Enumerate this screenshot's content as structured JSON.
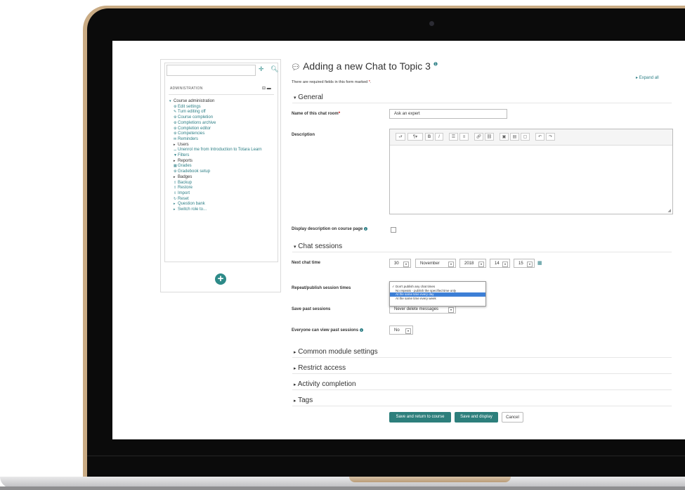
{
  "sidebar": {
    "title": "ADMINISTRATION",
    "items": [
      {
        "label": "Course administration",
        "icon": "caret-down-icon",
        "level": 0
      },
      {
        "label": "Edit settings",
        "icon": "gear-icon",
        "level": 1
      },
      {
        "label": "Turn editing off",
        "icon": "pencil-icon",
        "level": 1
      },
      {
        "label": "Course completion",
        "icon": "gear-icon",
        "level": 1
      },
      {
        "label": "Completions archive",
        "icon": "gear-icon",
        "level": 1
      },
      {
        "label": "Completion editor",
        "icon": "gear-icon",
        "level": 1
      },
      {
        "label": "Competencies",
        "icon": "gear-icon",
        "level": 1
      },
      {
        "label": "Reminders",
        "icon": "envelope-icon",
        "level": 1
      },
      {
        "label": "Users",
        "icon": "caret-right-icon",
        "level": 1
      },
      {
        "label": "Unenrol me from Introduction to Totara Learn",
        "icon": "user-minus-icon",
        "level": 1
      },
      {
        "label": "Filters",
        "icon": "filter-icon",
        "level": 1
      },
      {
        "label": "Reports",
        "icon": "caret-right-icon",
        "level": 1
      },
      {
        "label": "Grades",
        "icon": "table-icon",
        "level": 1
      },
      {
        "label": "Gradebook setup",
        "icon": "gear-icon",
        "level": 1
      },
      {
        "label": "Badges",
        "icon": "caret-right-icon",
        "level": 1
      },
      {
        "label": "Backup",
        "icon": "upload-icon",
        "level": 1
      },
      {
        "label": "Restore",
        "icon": "upload-icon",
        "level": 1
      },
      {
        "label": "Import",
        "icon": "upload-icon",
        "level": 1
      },
      {
        "label": "Reset",
        "icon": "reset-icon",
        "level": 1
      },
      {
        "label": "Question bank",
        "icon": "caret-right-icon",
        "level": 1
      },
      {
        "label": "Switch role to...",
        "icon": "caret-right-icon",
        "level": 1
      }
    ]
  },
  "page": {
    "title": "Adding a new Chat to Topic 3",
    "required_note": "There are required fields in this form marked",
    "required_star": "*",
    "expand_all": "Expand all"
  },
  "general": {
    "header": "General",
    "name_label": "Name of this chat room",
    "name_value": "Ask an expert",
    "description_label": "Description",
    "display_desc_label": "Display description on course page"
  },
  "chat_sessions": {
    "header": "Chat sessions",
    "next_time_label": "Next chat time",
    "day": "30",
    "month": "November",
    "year": "2018",
    "hour": "14",
    "minute": "15",
    "repeat_label": "Repeat/publish session times",
    "repeat_options": [
      "Don't publish any chat times",
      "No repeats - publish the specified time only",
      "At the same time every day",
      "At the same time every week"
    ],
    "repeat_selected": "Don't publish any chat times",
    "repeat_highlighted": "At the same time every day",
    "save_past_label": "Save past sessions",
    "save_past_value": "Never delete messages",
    "everyone_view_label": "Everyone can view past sessions",
    "everyone_view_value": "No"
  },
  "collapsed_sections": [
    "Common module settings",
    "Restrict access",
    "Activity completion",
    "Tags"
  ],
  "buttons": {
    "save_return": "Save and return to course",
    "save_display": "Save and display",
    "cancel": "Cancel"
  },
  "colors": {
    "accent": "#2d7f7c",
    "highlight": "#3d7fd6",
    "required": "#cc0000",
    "laptop_frame": "#c9ab84"
  }
}
